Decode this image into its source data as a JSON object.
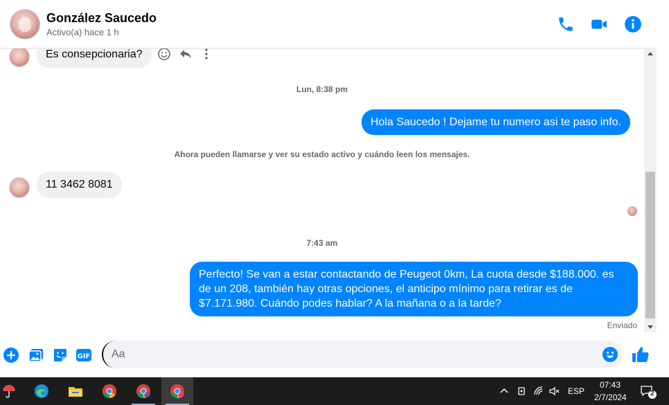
{
  "header": {
    "name": "González Saucedo",
    "status": "Activo(a) hace 1 h",
    "icons": [
      "phone-icon",
      "video-icon",
      "info-icon"
    ]
  },
  "messages": {
    "m1": "Es consepcionaria?",
    "ts1": "Lun, 8:38 pm",
    "m2": "Hola Saucedo ! Dejame tu numero  asi te paso info.",
    "sys1": "Ahora pueden llamarse y ver su estado activo y cuándo leen los mensajes.",
    "m3": "11 3462 8081",
    "ts2": "7:43 am",
    "m4": "Perfecto!  Se van a estar contactando de Peugeot 0km, La cuota desde $188.000. es de un 208, también hay otras opciones, el anticipo mínimo para retirar es de $7.171.980. Cuándo podes hablar? A la mañana o a la tarde?",
    "delivered": "Enviado"
  },
  "composer": {
    "placeholder": "Aa",
    "gif_label": "GIF"
  },
  "taskbar": {
    "language": "ESP",
    "time": "07:43",
    "date": "2/7/2024",
    "notifications": "2"
  },
  "colors": {
    "accent": "#0084ff",
    "bubble_in": "#f0f0f0"
  }
}
